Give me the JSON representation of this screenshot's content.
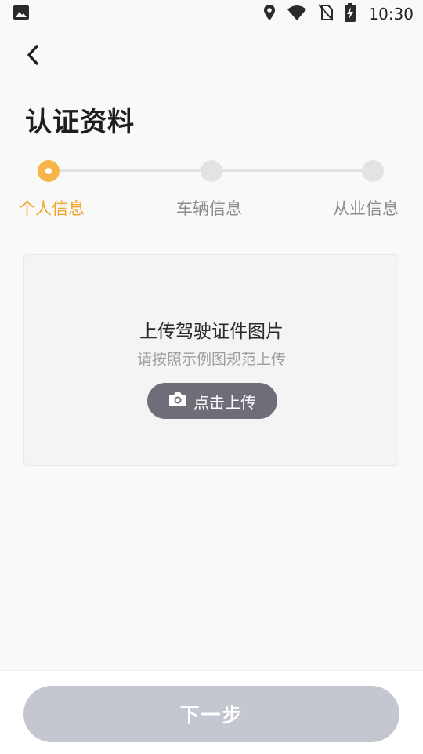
{
  "status_bar": {
    "time": "10:30",
    "icons": [
      "image-icon",
      "location-icon",
      "wifi-icon",
      "no-sim-icon",
      "battery-charging-icon"
    ]
  },
  "header": {
    "back_icon": "chevron-left-icon",
    "title": "认证资料"
  },
  "steps": [
    {
      "label": "个人信息",
      "active": true
    },
    {
      "label": "车辆信息",
      "active": false
    },
    {
      "label": "从业信息",
      "active": false
    }
  ],
  "upload": {
    "title": "上传驾驶证件图片",
    "subtitle": "请按照示例图规范上传",
    "button_label": "点击上传",
    "button_icon": "camera-icon"
  },
  "footer": {
    "next_label": "下一步",
    "next_enabled": false
  },
  "colors": {
    "accent": "#f5b548",
    "accent_text": "#f0a52e",
    "upload_button": "#6d6e78",
    "next_button_disabled": "#c4c6d0"
  }
}
